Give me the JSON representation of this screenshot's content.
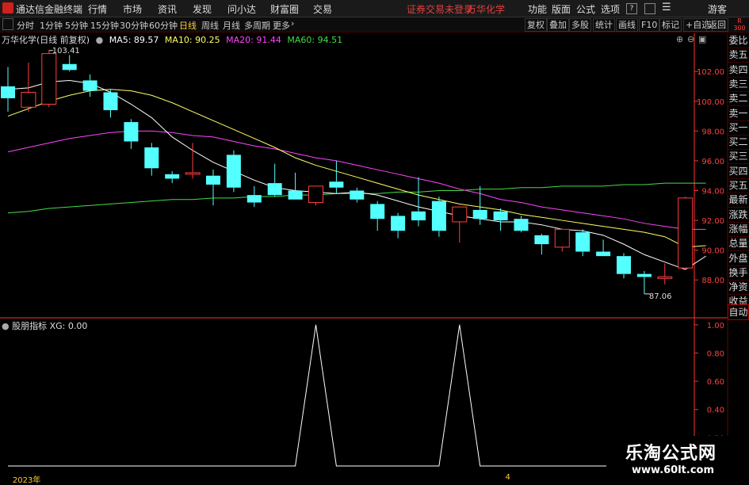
{
  "titlebar": {
    "app_name": "通达信金融终端",
    "menus": [
      "行情",
      "市场",
      "资讯",
      "发现",
      "问小达",
      "财富圈",
      "交易"
    ],
    "notice": "证券交易未登录",
    "stock": "万华化学",
    "right_menus": [
      "功能",
      "版面",
      "公式",
      "选项"
    ],
    "guest": "游客"
  },
  "toolbar": {
    "periods": [
      "分时",
      "1分钟",
      "5分钟",
      "15分钟",
      "30分钟",
      "60分钟",
      "日线",
      "周线",
      "月线",
      "多周期",
      "更多"
    ],
    "active_period": "日线",
    "right_buttons": [
      "复权",
      "叠加",
      "多股",
      "统计",
      "画线",
      "F10",
      "标记",
      "+自选",
      "返回"
    ],
    "corner_top": "R",
    "corner_bottom": "300"
  },
  "chart_legend": {
    "title": "万华化学(日线 前复权)",
    "ma5": "MA5: 89.57",
    "ma10": "MA10: 90.25",
    "ma20": "MA20: 91.44",
    "ma60": "MA60: 94.51",
    "colors": {
      "ma5": "#ffffff",
      "ma10": "#ffff66",
      "ma20": "#ff44ff",
      "ma60": "#44dd44",
      "up": "#ff4040",
      "down": "#54ffff",
      "axis": "#ff3030"
    }
  },
  "side_panel": [
    "委比",
    "卖五",
    "卖四",
    "卖三",
    "卖二",
    "卖一",
    "买一",
    "买二",
    "买三",
    "买四",
    "买五",
    "最新",
    "涨跌",
    "涨幅",
    "总量",
    "外盘",
    "换手",
    "净资",
    "收益",
    "自动"
  ],
  "indicator": {
    "name": "股朋指标",
    "value": "XG: 0.00"
  },
  "chart_data": {
    "type": "candlestick",
    "price_axis": {
      "min": 87,
      "max": 103.5,
      "ticks": [
        88,
        90,
        92,
        94,
        96,
        98,
        100,
        102
      ],
      "tick_labels": [
        "88.00",
        "90.00",
        "92.00",
        "94.00",
        "96.00",
        "98.00",
        "100.00",
        "102.00"
      ]
    },
    "high_label": "103.41",
    "low_label": "87.06",
    "candles": [
      {
        "o": 101.0,
        "h": 102.3,
        "l": 99.3,
        "c": 100.2
      },
      {
        "o": 99.6,
        "h": 102.6,
        "l": 99.3,
        "c": 100.6
      },
      {
        "o": 99.8,
        "h": 103.41,
        "l": 99.6,
        "c": 103.2
      },
      {
        "o": 102.5,
        "h": 103.1,
        "l": 102.0,
        "c": 102.1
      },
      {
        "o": 101.4,
        "h": 101.8,
        "l": 100.3,
        "c": 100.7
      },
      {
        "o": 100.6,
        "h": 100.8,
        "l": 98.9,
        "c": 99.4
      },
      {
        "o": 98.6,
        "h": 98.8,
        "l": 96.8,
        "c": 97.3
      },
      {
        "o": 96.9,
        "h": 97.2,
        "l": 95.0,
        "c": 95.5
      },
      {
        "o": 95.1,
        "h": 95.3,
        "l": 94.5,
        "c": 94.8
      },
      {
        "o": 95.1,
        "h": 97.2,
        "l": 94.8,
        "c": 95.2
      },
      {
        "o": 95.0,
        "h": 95.4,
        "l": 93.0,
        "c": 94.4
      },
      {
        "o": 96.4,
        "h": 96.7,
        "l": 93.9,
        "c": 94.2
      },
      {
        "o": 93.7,
        "h": 94.3,
        "l": 92.9,
        "c": 93.2
      },
      {
        "o": 94.5,
        "h": 95.8,
        "l": 93.6,
        "c": 93.7
      },
      {
        "o": 94.0,
        "h": 95.2,
        "l": 93.4,
        "c": 93.4
      },
      {
        "o": 93.2,
        "h": 94.3,
        "l": 93.0,
        "c": 94.3
      },
      {
        "o": 94.6,
        "h": 96.0,
        "l": 93.8,
        "c": 94.2
      },
      {
        "o": 94.0,
        "h": 94.2,
        "l": 93.2,
        "c": 93.4
      },
      {
        "o": 93.1,
        "h": 93.3,
        "l": 91.3,
        "c": 92.1
      },
      {
        "o": 92.3,
        "h": 92.5,
        "l": 90.8,
        "c": 91.3
      },
      {
        "o": 92.6,
        "h": 94.9,
        "l": 91.6,
        "c": 92.0
      },
      {
        "o": 93.3,
        "h": 93.6,
        "l": 90.9,
        "c": 91.3
      },
      {
        "o": 91.9,
        "h": 92.9,
        "l": 90.5,
        "c": 92.9
      },
      {
        "o": 92.7,
        "h": 94.3,
        "l": 91.7,
        "c": 92.1
      },
      {
        "o": 92.6,
        "h": 92.8,
        "l": 91.3,
        "c": 92.0
      },
      {
        "o": 92.1,
        "h": 92.3,
        "l": 91.2,
        "c": 91.3
      },
      {
        "o": 91.0,
        "h": 91.1,
        "l": 89.7,
        "c": 90.4
      },
      {
        "o": 90.2,
        "h": 91.4,
        "l": 89.9,
        "c": 91.4
      },
      {
        "o": 91.2,
        "h": 91.4,
        "l": 89.6,
        "c": 89.9
      },
      {
        "o": 89.9,
        "h": 90.7,
        "l": 89.6,
        "c": 89.6
      },
      {
        "o": 89.6,
        "h": 89.8,
        "l": 88.1,
        "c": 88.4
      },
      {
        "o": 88.4,
        "h": 88.6,
        "l": 87.06,
        "c": 88.2
      },
      {
        "o": 88.1,
        "h": 89.1,
        "l": 87.7,
        "c": 88.2
      },
      {
        "o": 88.8,
        "h": 93.6,
        "l": 88.7,
        "c": 93.5
      }
    ],
    "ma5": [
      100.8,
      100.9,
      101.3,
      101.4,
      101.2,
      100.6,
      99.8,
      98.9,
      97.6,
      96.7,
      95.9,
      95.3,
      94.7,
      94.2,
      94.0,
      93.9,
      93.8,
      93.9,
      93.7,
      93.3,
      92.9,
      92.6,
      92.3,
      92.1,
      91.9,
      91.9,
      91.7,
      91.4,
      91.3,
      91.0,
      90.4,
      89.7,
      89.2,
      88.7,
      89.6
    ],
    "ma10": [
      99.0,
      99.5,
      100.0,
      100.4,
      100.7,
      100.8,
      100.7,
      100.4,
      99.9,
      99.3,
      98.7,
      98.1,
      97.5,
      96.9,
      96.2,
      95.7,
      95.3,
      94.9,
      94.5,
      94.1,
      93.7,
      93.4,
      93.1,
      92.9,
      92.7,
      92.4,
      92.2,
      92.0,
      91.8,
      91.6,
      91.4,
      91.2,
      90.9,
      90.2,
      90.3
    ],
    "ma20": [
      96.6,
      96.9,
      97.2,
      97.5,
      97.7,
      97.9,
      98.0,
      98.0,
      97.9,
      97.7,
      97.6,
      97.3,
      97.0,
      96.8,
      96.5,
      96.2,
      96.0,
      95.7,
      95.4,
      95.1,
      94.8,
      94.5,
      94.1,
      93.8,
      93.4,
      93.2,
      92.9,
      92.7,
      92.5,
      92.3,
      92.1,
      91.8,
      91.6,
      91.4,
      91.4
    ],
    "ma60": [
      92.5,
      92.6,
      92.8,
      92.9,
      93.0,
      93.1,
      93.2,
      93.3,
      93.4,
      93.4,
      93.5,
      93.5,
      93.6,
      93.6,
      93.7,
      93.7,
      93.8,
      93.8,
      93.8,
      93.9,
      93.9,
      94.0,
      94.0,
      94.1,
      94.1,
      94.2,
      94.2,
      94.3,
      94.3,
      94.3,
      94.4,
      94.4,
      94.5,
      94.5,
      94.5
    ],
    "indicator_series": {
      "name": "XG",
      "ylim": [
        0,
        1.1
      ],
      "ticks": [
        1.0,
        0.8,
        0.6,
        0.4,
        0.2
      ],
      "tick_labels": [
        "1.00",
        "0.80",
        "0.60",
        "0.40",
        "0.20"
      ],
      "values": [
        0,
        0,
        0,
        0,
        0,
        0,
        0,
        0,
        0,
        0,
        0,
        0,
        0,
        0,
        0,
        1,
        0,
        0,
        0,
        0,
        0,
        0,
        1,
        0,
        0,
        0,
        0,
        0,
        0,
        0,
        0,
        0,
        0,
        0,
        0
      ]
    },
    "date_labels": [
      {
        "index": 1,
        "text": "2023年"
      },
      {
        "index": 25,
        "text": "4"
      }
    ]
  },
  "watermark": {
    "title": "乐淘公式网",
    "url": "www.60lt.com"
  }
}
